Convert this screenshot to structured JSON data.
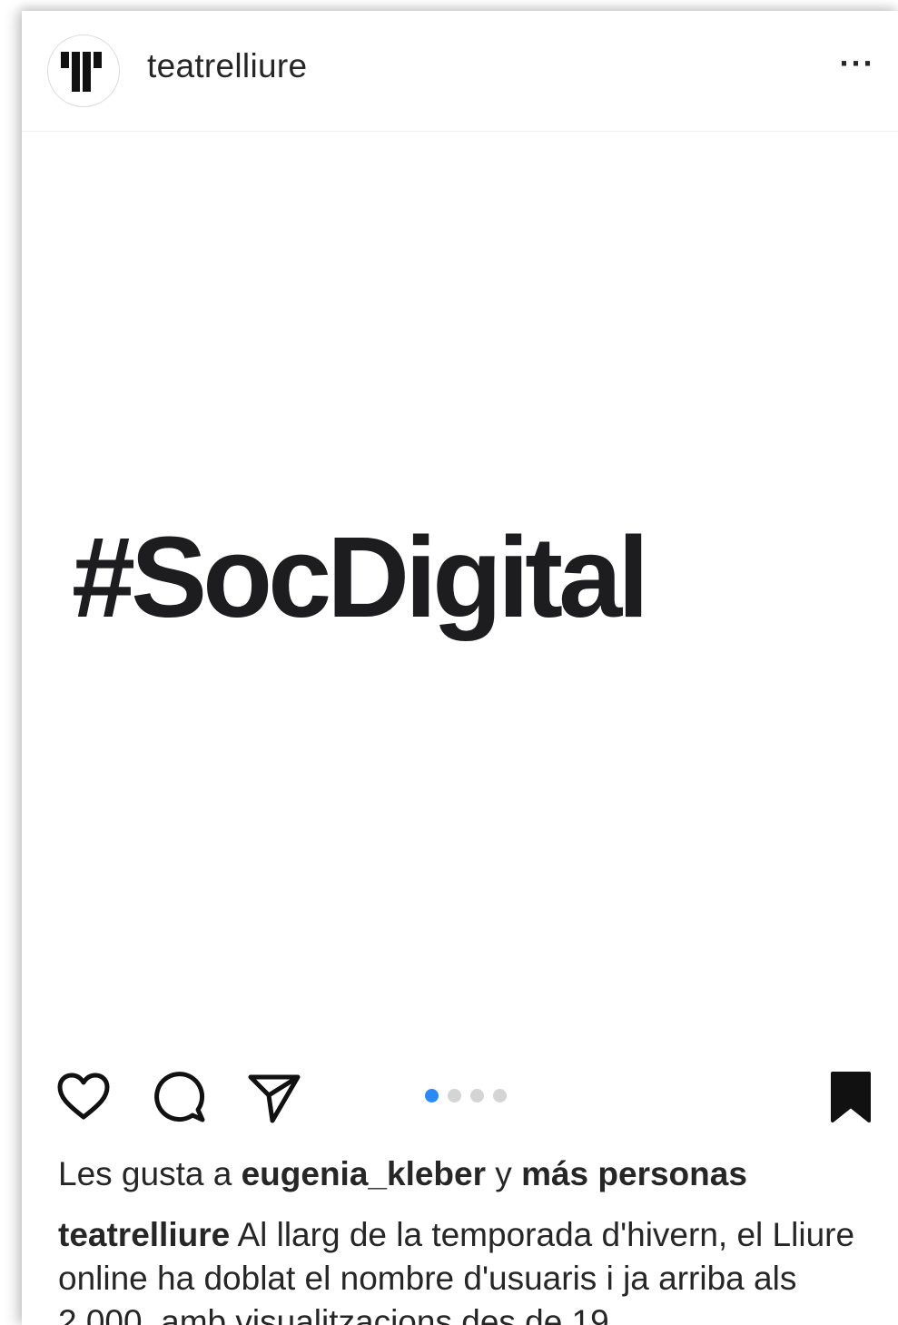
{
  "post": {
    "username": "teatrelliure",
    "more_label": "···",
    "image_text": "#SocDigital",
    "likes": {
      "prefix": "Les gusta a ",
      "user": "eugenia_kleber",
      "connector": " y ",
      "others": "más personas"
    },
    "caption": {
      "author": "teatrelliure",
      "text": " Al llarg de la temporada d'hivern, el Lliure online ha doblat el nombre d'usuaris i ja arriba als 2.000, amb visualitzacions des de 19"
    },
    "carousel": {
      "total": 4,
      "active": 1
    }
  },
  "icons": {
    "avatar": "teatre-lliure-logo-icon",
    "like": "heart-icon",
    "comment": "comment-bubble-icon",
    "share": "paper-plane-icon",
    "save": "bookmark-filled-icon"
  },
  "colors": {
    "text": "#262626",
    "active_dot": "#2b8af5",
    "inactive_dot": "#d4d4d4"
  }
}
